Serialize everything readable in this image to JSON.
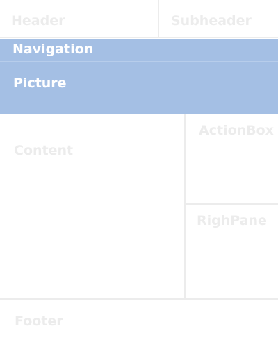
{
  "regions": {
    "header": "Header",
    "subheader": "Subheader",
    "navigation": "Navigation",
    "picture": "Picture",
    "content": "Content",
    "actionbox": "ActionBox",
    "righpane": "RighPane",
    "footer": "Footer"
  },
  "colors": {
    "band": "#a4bfe4",
    "label_light": "#ececec",
    "label_on_band": "#ffffff"
  }
}
